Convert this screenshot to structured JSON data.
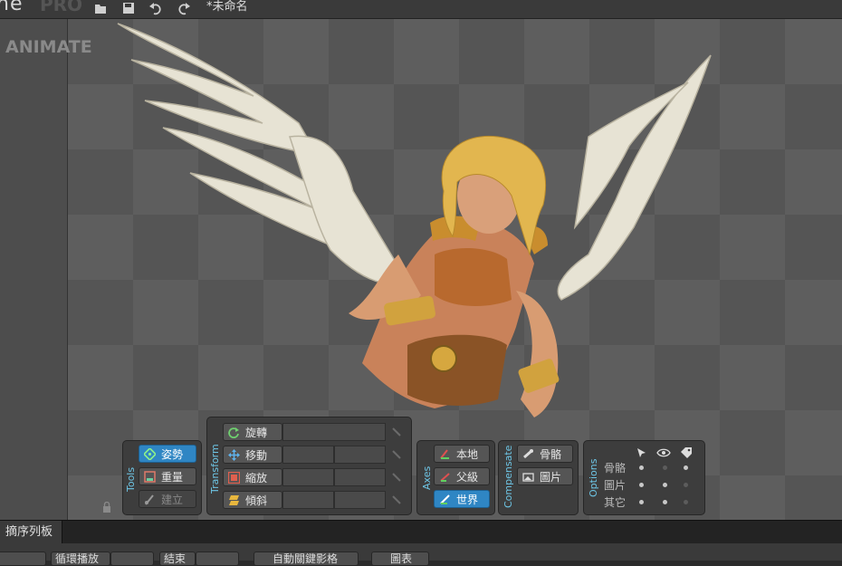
{
  "app": {
    "brand": "ne",
    "edition": "PRO",
    "document_title": "*未命名",
    "mode": "ANIMATE"
  },
  "toolbar": {
    "icons": [
      "open-folder-icon",
      "save-icon",
      "undo-icon",
      "redo-icon"
    ]
  },
  "tools": {
    "label": "Tools",
    "items": [
      {
        "label": "姿勢",
        "icon": "pose-icon",
        "state": "active"
      },
      {
        "label": "重量",
        "icon": "weights-icon",
        "state": "normal"
      },
      {
        "label": "建立",
        "icon": "create-icon",
        "state": "disabled"
      }
    ]
  },
  "transform": {
    "label": "Transform",
    "items": [
      {
        "label": "旋轉",
        "icon": "rotate-icon"
      },
      {
        "label": "移動",
        "icon": "move-icon"
      },
      {
        "label": "縮放",
        "icon": "scale-icon"
      },
      {
        "label": "傾斜",
        "icon": "shear-icon"
      }
    ]
  },
  "axes": {
    "label": "Axes",
    "items": [
      {
        "label": "本地",
        "icon": "local-axes-icon",
        "state": "normal"
      },
      {
        "label": "父級",
        "icon": "parent-axes-icon",
        "state": "normal"
      },
      {
        "label": "世界",
        "icon": "world-axes-icon",
        "state": "active"
      }
    ]
  },
  "compensate": {
    "label": "Compensate",
    "items": [
      {
        "label": "骨骼",
        "icon": "bone-compensate-icon"
      },
      {
        "label": "圖片",
        "icon": "image-compensate-icon"
      }
    ]
  },
  "options": {
    "label": "Options",
    "header_icons": [
      "cursor-icon",
      "eye-icon",
      "tag-icon"
    ],
    "rows": [
      {
        "label": "骨骼",
        "values": [
          true,
          false,
          true
        ]
      },
      {
        "label": "圖片",
        "values": [
          true,
          true,
          false
        ]
      },
      {
        "label": "其它",
        "values": [
          true,
          true,
          false
        ]
      }
    ]
  },
  "bottom": {
    "tab": "摘序列板",
    "buttons": [
      "",
      "循環播放",
      "",
      "結束",
      "",
      "自動關鍵影格",
      "圖表"
    ]
  },
  "colors": {
    "accent": "#2f86c4",
    "label_blue": "#6ec6e6"
  }
}
